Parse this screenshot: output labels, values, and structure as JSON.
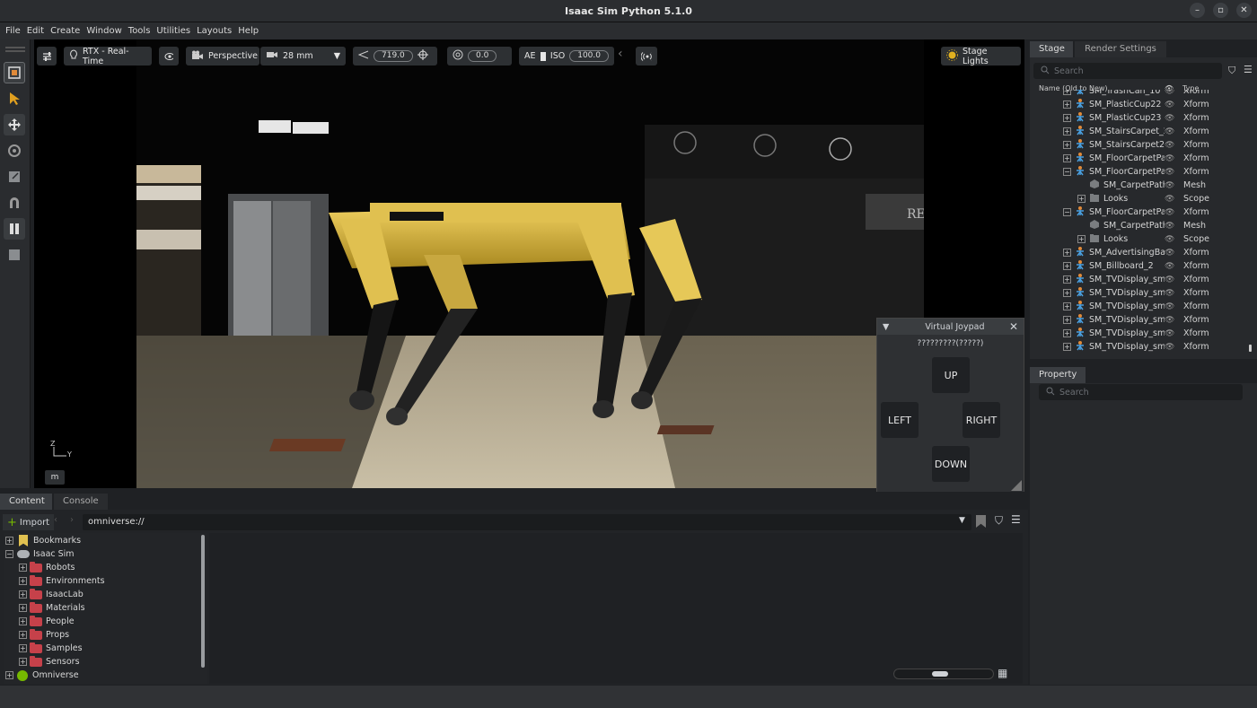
{
  "window": {
    "title": "Isaac Sim Python 5.1.0"
  },
  "menu": [
    "File",
    "Edit",
    "Create",
    "Window",
    "Tools",
    "Utilities",
    "Layouts",
    "Help"
  ],
  "viewport_toolbar": {
    "renderer": "RTX - Real-Time",
    "camera": "Perspective",
    "focal": "28 mm",
    "aperture_value": "719.0",
    "exposure_value": "0.0",
    "ae_label": "AE",
    "iso_label": "ISO",
    "iso_value": "100.0",
    "stage_lights": "Stage Lights"
  },
  "viewport": {
    "axis_z": "Z",
    "axis_y": "Y",
    "unit_badge": "m",
    "sign_text": "RE"
  },
  "joypad": {
    "title": "Virtual Joypad",
    "status": "?????????(?????)",
    "up": "UP",
    "left": "LEFT",
    "right": "RIGHT",
    "down": "DOWN"
  },
  "stage": {
    "tabs": [
      "Stage",
      "Render Settings"
    ],
    "search_placeholder": "Search",
    "col_name": "Name (Old to New)",
    "col_type": "Type",
    "rows": [
      {
        "name": "SM_TrashCan_10",
        "type": "Xform",
        "indent": 0,
        "exp": "+",
        "icon": "xform"
      },
      {
        "name": "SM_PlasticCup22",
        "type": "Xform",
        "indent": 0,
        "exp": "+",
        "icon": "xform"
      },
      {
        "name": "SM_PlasticCup23",
        "type": "Xform",
        "indent": 0,
        "exp": "+",
        "icon": "xform"
      },
      {
        "name": "SM_StairsCarpet_2",
        "type": "Xform",
        "indent": 0,
        "exp": "+",
        "icon": "xform"
      },
      {
        "name": "SM_StairsCarpet2",
        "type": "Xform",
        "indent": 0,
        "exp": "+",
        "icon": "xform"
      },
      {
        "name": "SM_FloorCarpetPat",
        "type": "Xform",
        "indent": 0,
        "exp": "+",
        "icon": "xform"
      },
      {
        "name": "SM_FloorCarpetPat",
        "type": "Xform",
        "indent": 0,
        "exp": "-",
        "icon": "xform-open"
      },
      {
        "name": "SM_CarpetPath",
        "type": "Mesh",
        "indent": 1,
        "exp": "",
        "icon": "mesh"
      },
      {
        "name": "Looks",
        "type": "Scope",
        "indent": 1,
        "exp": "+",
        "icon": "folder"
      },
      {
        "name": "SM_FloorCarpetPat",
        "type": "Xform",
        "indent": 0,
        "exp": "-",
        "icon": "xform-open"
      },
      {
        "name": "SM_CarpetPath",
        "type": "Mesh",
        "indent": 1,
        "exp": "",
        "icon": "mesh"
      },
      {
        "name": "Looks",
        "type": "Scope",
        "indent": 1,
        "exp": "+",
        "icon": "folder"
      },
      {
        "name": "SM_AdvertisingBar",
        "type": "Xform",
        "indent": 0,
        "exp": "+",
        "icon": "xform"
      },
      {
        "name": "SM_Billboard_2",
        "type": "Xform",
        "indent": 0,
        "exp": "+",
        "icon": "xform"
      },
      {
        "name": "SM_TVDisplay_sma",
        "type": "Xform",
        "indent": 0,
        "exp": "+",
        "icon": "xform"
      },
      {
        "name": "SM_TVDisplay_sma",
        "type": "Xform",
        "indent": 0,
        "exp": "+",
        "icon": "xform"
      },
      {
        "name": "SM_TVDisplay_sma",
        "type": "Xform",
        "indent": 0,
        "exp": "+",
        "icon": "xform"
      },
      {
        "name": "SM_TVDisplay_sma",
        "type": "Xform",
        "indent": 0,
        "exp": "+",
        "icon": "xform"
      },
      {
        "name": "SM_TVDisplay_sma",
        "type": "Xform",
        "indent": 0,
        "exp": "+",
        "icon": "xform"
      },
      {
        "name": "SM_TVDisplay_sma",
        "type": "Xform",
        "indent": 0,
        "exp": "+",
        "icon": "xform"
      }
    ]
  },
  "property": {
    "tab": "Property",
    "search_placeholder": "Search"
  },
  "content": {
    "tabs": [
      "Content",
      "Console"
    ],
    "import_label": "Import",
    "path": "omniverse://",
    "tree": [
      {
        "label": "Bookmarks",
        "level": 0,
        "exp": "+",
        "icon": "bookmark"
      },
      {
        "label": "Isaac Sim",
        "level": 0,
        "exp": "-",
        "icon": "cloud"
      },
      {
        "label": "Robots",
        "level": 1,
        "exp": "+",
        "icon": "folder"
      },
      {
        "label": "Environments",
        "level": 1,
        "exp": "+",
        "icon": "folder"
      },
      {
        "label": "IsaacLab",
        "level": 1,
        "exp": "+",
        "icon": "folder"
      },
      {
        "label": "Materials",
        "level": 1,
        "exp": "+",
        "icon": "folder"
      },
      {
        "label": "People",
        "level": 1,
        "exp": "+",
        "icon": "folder"
      },
      {
        "label": "Props",
        "level": 1,
        "exp": "+",
        "icon": "folder"
      },
      {
        "label": "Samples",
        "level": 1,
        "exp": "+",
        "icon": "folder"
      },
      {
        "label": "Sensors",
        "level": 1,
        "exp": "+",
        "icon": "folder"
      },
      {
        "label": "Omniverse",
        "level": 0,
        "exp": "+",
        "icon": "omniverse"
      }
    ]
  },
  "colors": {
    "accent": "#76b900",
    "robot": "#e0c050",
    "xform_icon": "#e08a3a",
    "folder_red": "#c6414a"
  }
}
